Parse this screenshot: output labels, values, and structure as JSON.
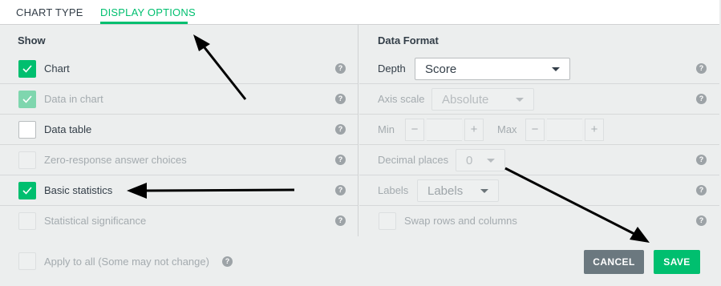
{
  "tabs": {
    "chart_type": "CHART TYPE",
    "display_options": "DISPLAY OPTIONS"
  },
  "show": {
    "title": "Show",
    "items": [
      {
        "label": "Chart",
        "state": "checked"
      },
      {
        "label": "Data in chart",
        "state": "checked-disabled"
      },
      {
        "label": "Data table",
        "state": "unchecked"
      },
      {
        "label": "Zero-response answer choices",
        "state": "disabled"
      },
      {
        "label": "Basic statistics",
        "state": "checked"
      },
      {
        "label": "Statistical significance",
        "state": "disabled"
      }
    ]
  },
  "data_format": {
    "title": "Data Format",
    "depth_label": "Depth",
    "depth_value": "Score",
    "axis_scale_label": "Axis scale",
    "axis_scale_value": "Absolute",
    "min_label": "Min",
    "max_label": "Max",
    "decimal_places_label": "Decimal places",
    "decimal_places_value": "0",
    "labels_label": "Labels",
    "labels_value": "Labels",
    "swap_label": "Swap rows and columns",
    "minus_glyph": "−",
    "plus_glyph": "+"
  },
  "help_glyph": "?",
  "footer": {
    "apply_all_label": "Apply to all (Some may not change)",
    "cancel_label": "CANCEL",
    "save_label": "SAVE"
  },
  "colors": {
    "accent": "#00bf6f",
    "cancel_button": "#6b787f",
    "background": "#eceeee",
    "annotation_arrow": "#000000"
  },
  "icons": {
    "checkmark": "check-icon",
    "help": "question-circle-icon",
    "dropdown": "caret-down-icon",
    "annotation": "arrow-icon"
  }
}
